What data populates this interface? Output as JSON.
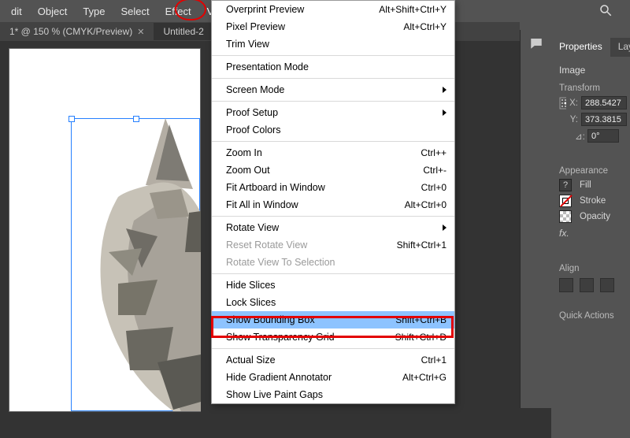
{
  "menubar": {
    "items": [
      {
        "label": "dit"
      },
      {
        "label": "Object"
      },
      {
        "label": "Type"
      },
      {
        "label": "Select"
      },
      {
        "label": "Effect"
      },
      {
        "label": "View"
      }
    ]
  },
  "tabs": {
    "items": [
      {
        "label": "1* @ 150 % (CMYK/Preview)",
        "active": false
      },
      {
        "label": "Untitled-2",
        "active": true
      }
    ]
  },
  "dropdown": {
    "items": [
      {
        "label": "Overprint Preview",
        "accel": "Alt+Shift+Ctrl+Y"
      },
      {
        "label": "Pixel Preview",
        "accel": "Alt+Ctrl+Y"
      },
      {
        "label": "Trim View"
      },
      {
        "sep": true
      },
      {
        "label": "Presentation Mode"
      },
      {
        "sep": true
      },
      {
        "label": "Screen Mode",
        "submenu": true
      },
      {
        "sep": true
      },
      {
        "label": "Proof Setup",
        "submenu": true
      },
      {
        "label": "Proof Colors"
      },
      {
        "sep": true
      },
      {
        "label": "Zoom In",
        "accel": "Ctrl++"
      },
      {
        "label": "Zoom Out",
        "accel": "Ctrl+-"
      },
      {
        "label": "Fit Artboard in Window",
        "accel": "Ctrl+0"
      },
      {
        "label": "Fit All in Window",
        "accel": "Alt+Ctrl+0"
      },
      {
        "sep": true
      },
      {
        "label": "Rotate View",
        "submenu": true
      },
      {
        "label": "Reset Rotate View",
        "accel": "Shift+Ctrl+1",
        "disabled": true
      },
      {
        "label": "Rotate View To Selection",
        "disabled": true
      },
      {
        "sep": true
      },
      {
        "label": "Hide Slices"
      },
      {
        "label": "Lock Slices"
      },
      {
        "label": "Show Bounding Box",
        "accel": "Shift+Ctrl+B",
        "selected": true
      },
      {
        "label": "Show Transparency Grid",
        "accel": "Shift+Ctrl+D"
      },
      {
        "sep": true
      },
      {
        "label": "Actual Size",
        "accel": "Ctrl+1"
      },
      {
        "label": "Hide Gradient Annotator",
        "accel": "Alt+Ctrl+G"
      },
      {
        "label": "Show Live Paint Gaps"
      }
    ]
  },
  "props": {
    "tabs": [
      {
        "label": "Properties",
        "active": true
      },
      {
        "label": "Laye",
        "active": false
      }
    ],
    "object_type": "Image",
    "transform": {
      "title": "Transform",
      "x_label": "X:",
      "x_value": "288.5427",
      "y_label": "Y:",
      "y_value": "373.3815",
      "rot_label": "⊿:",
      "rot_value": "0°"
    },
    "appearance": {
      "title": "Appearance",
      "fill_label": "Fill",
      "stroke_label": "Stroke",
      "opacity_label": "Opacity"
    },
    "fx_label": "fx.",
    "align": {
      "title": "Align"
    },
    "quick_actions": {
      "title": "Quick Actions"
    }
  }
}
